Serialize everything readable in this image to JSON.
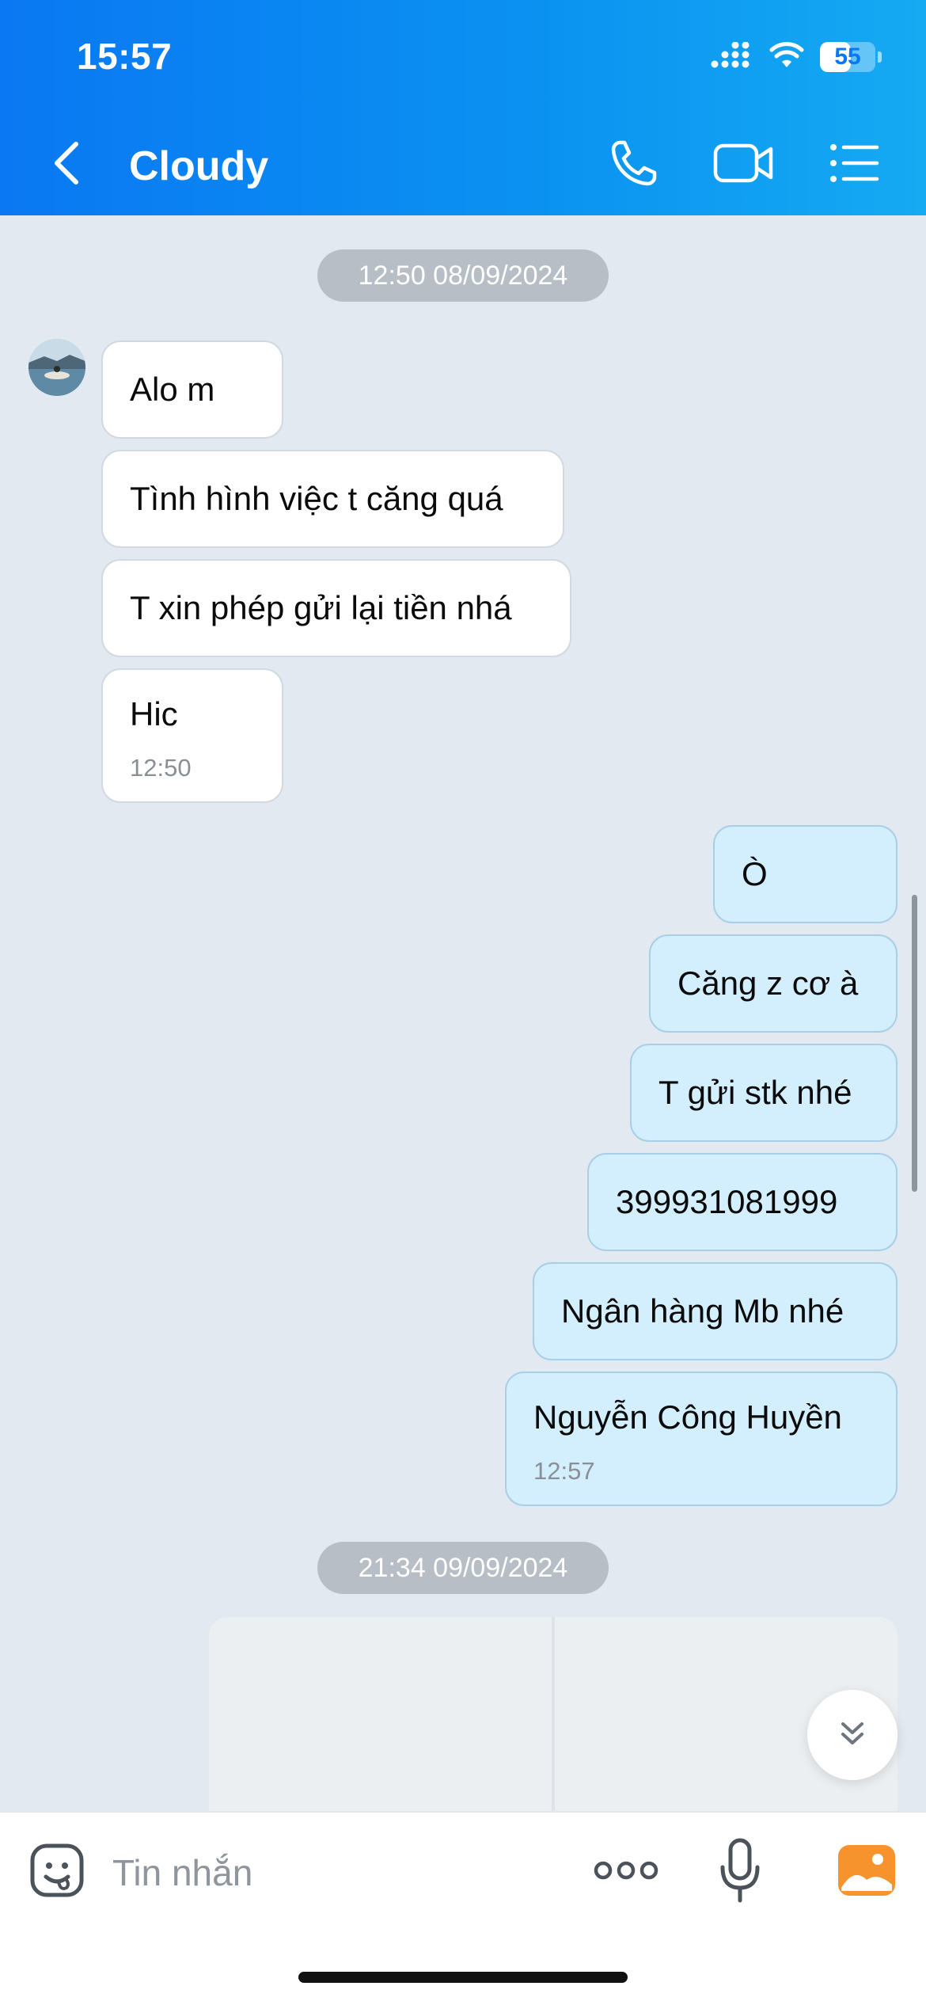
{
  "status_bar": {
    "time": "15:57",
    "battery_level": "55",
    "battery_fraction": 0.55
  },
  "header": {
    "title": "Cloudy",
    "icons": [
      "back-chevron-icon",
      "phone-icon",
      "video-camera-icon",
      "menu-list-icon"
    ]
  },
  "messages": {
    "date_1": "12:50 08/09/2024",
    "incoming": [
      {
        "text": "Alo m"
      },
      {
        "text": "Tình hình việc t căng quá"
      },
      {
        "text": "T xin phép gửi lại tiền nhá"
      },
      {
        "text": "Hic",
        "time": "12:50"
      }
    ],
    "outgoing": [
      {
        "text": "Ò"
      },
      {
        "text": "Căng z cơ à"
      },
      {
        "text": "T gửi stk nhé"
      },
      {
        "text": "399931081999"
      },
      {
        "text": "Ngân hàng Mb nhé"
      },
      {
        "text": "Nguyễn Công Huyền",
        "time": "12:57"
      }
    ],
    "date_2": "21:34 09/09/2024"
  },
  "input_bar": {
    "placeholder": "Tin nhắn",
    "value": "",
    "icons": [
      "sticker-icon",
      "more-icon",
      "microphone-icon",
      "image-gallery-icon"
    ]
  },
  "colors": {
    "header_start": "#0a78f2",
    "header_end": "#15aaf2",
    "chat_background": "#e2e9f1",
    "outgoing_bubble": "#d3eefd",
    "incoming_bubble": "#ffffff",
    "accent_orange": "#f7932c"
  }
}
